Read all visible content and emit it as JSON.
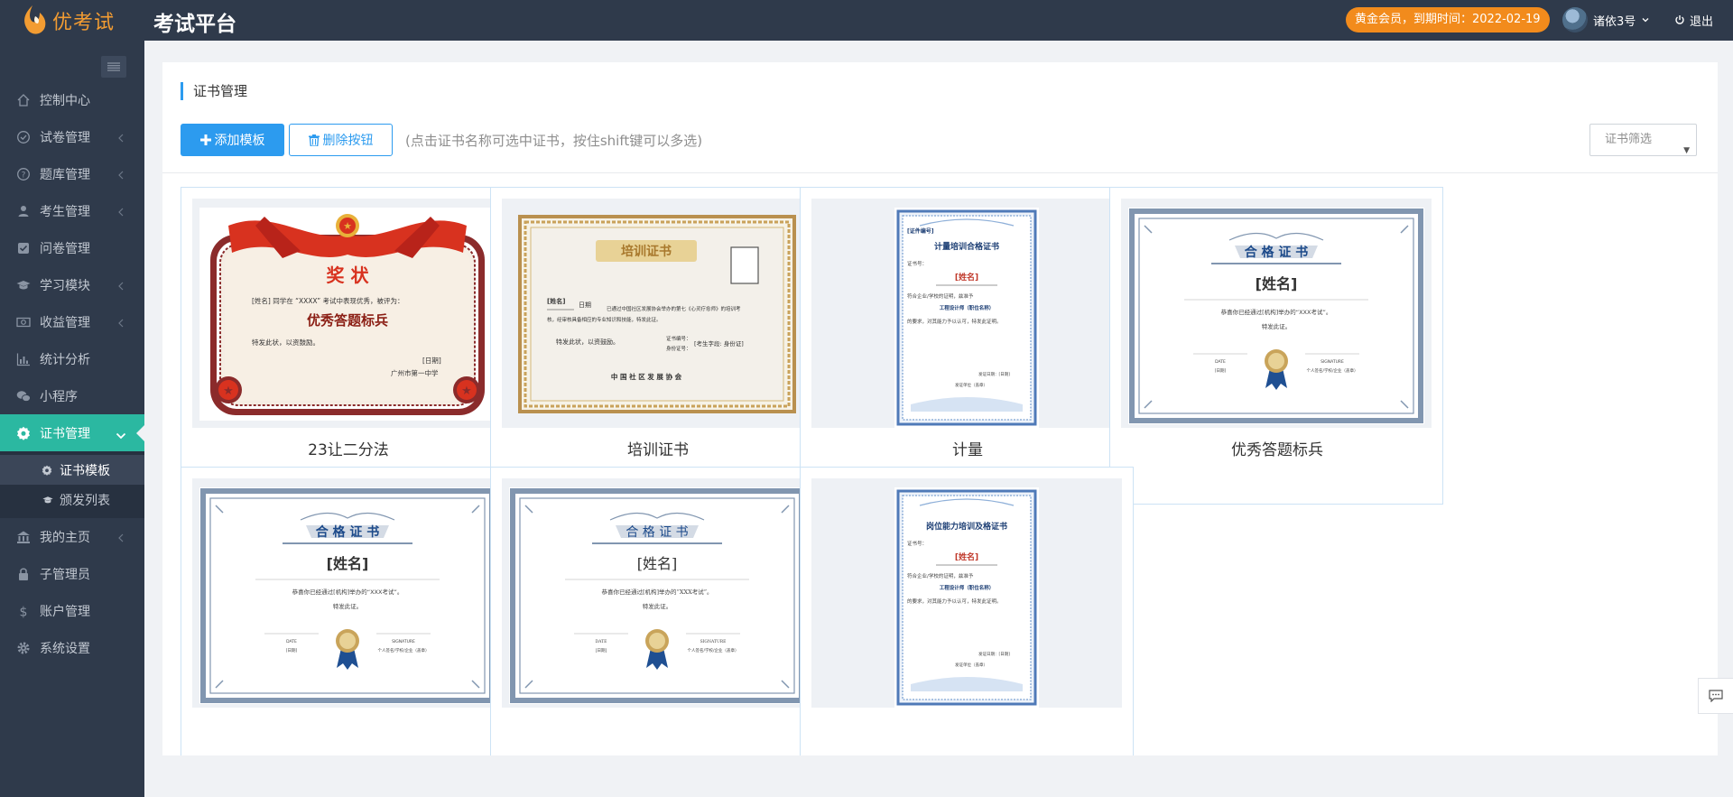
{
  "brand": {
    "logo_text": "优考试",
    "app_title": "考试平台"
  },
  "header": {
    "vip_label": "黄金会员，到期时间：2022-02-19",
    "username": "诸依3号",
    "logout_label": "退出"
  },
  "sidebar": {
    "items": [
      {
        "label": "控制中心",
        "icon": "home-icon",
        "expandable": false
      },
      {
        "label": "试卷管理",
        "icon": "check-circle-icon",
        "expandable": true
      },
      {
        "label": "题库管理",
        "icon": "question-circle-icon",
        "expandable": true
      },
      {
        "label": "考生管理",
        "icon": "user-icon",
        "expandable": true
      },
      {
        "label": "问卷管理",
        "icon": "checkbox-icon",
        "expandable": false
      },
      {
        "label": "学习模块",
        "icon": "graduation-cap-icon",
        "expandable": true
      },
      {
        "label": "收益管理",
        "icon": "money-icon",
        "expandable": true
      },
      {
        "label": "统计分析",
        "icon": "bar-chart-icon",
        "expandable": false
      },
      {
        "label": "小程序",
        "icon": "wechat-icon",
        "expandable": false
      },
      {
        "label": "证书管理",
        "icon": "certificate-icon",
        "expandable": true,
        "active": true
      },
      {
        "label": "我的主页",
        "icon": "bank-icon",
        "expandable": true
      },
      {
        "label": "子管理员",
        "icon": "lock-icon",
        "expandable": false
      },
      {
        "label": "账户管理",
        "icon": "dollar-icon",
        "expandable": false
      },
      {
        "label": "系统设置",
        "icon": "gear-icon",
        "expandable": false
      }
    ],
    "sub_items": [
      {
        "label": "证书模板",
        "icon": "certificate-small-icon",
        "current": true
      },
      {
        "label": "颁发列表",
        "icon": "graduation-cap-small-icon",
        "current": false
      }
    ]
  },
  "main": {
    "title": "证书管理",
    "add_button": "添加模板",
    "delete_button": "删除按钮",
    "hint": "(点击证书名称可选中证书，按住shift键可以多选)",
    "filter_placeholder": "证书筛选"
  },
  "certificates": [
    {
      "name": "23让二分法",
      "style": "award",
      "texts": {
        "heading": "奖 状",
        "line1": "[姓名] 同学在 “XXXX” 考试中表现优秀，被评为：",
        "title": "优秀答题标兵",
        "line2": "特发此状，以资鼓励。",
        "date": "[日期]",
        "org": "广州市第一中学"
      }
    },
    {
      "name": "培训证书",
      "style": "training",
      "texts": {
        "heading": "培训证书",
        "name_field": "[姓名]",
        "date_field": "日期",
        "line1": "已通过中国社区发展协会举办的第七《心灵疗愈师》的培训考",
        "line2": "核，经审核具备相应的专业知识和技能，特发此证。",
        "line3": "特发此状，以资鼓励。",
        "cert_no": "证书编号：",
        "id_no": "身份证号：",
        "id_field": "[考生字段: 身份证]",
        "org": "中 国 社 区 发 展 协 会"
      }
    },
    {
      "name": "计量",
      "style": "blue-portrait",
      "texts": {
        "corner": "[证件编号]",
        "heading": "计量培训合格证书",
        "cert_label": "证书号：",
        "name_field": "[姓名]",
        "line1": "符合企业/学校的证明，兹准予",
        "line2": "工程设计师（职位名称）",
        "line3": "的要求，对其能力予以认可，特发此证明。",
        "sign": "发证日期：[日期]",
        "org": "发证单位（盖章）"
      }
    },
    {
      "name": "优秀答题标兵",
      "style": "blue-frame",
      "texts": {
        "heading": "合 格 证 书",
        "name_field": "[姓名]",
        "line1": "恭喜你已经通过[机构]举办的“XXX考试”。",
        "line2": "特发此证。",
        "date_label": "DATE",
        "date_field": "[日期]",
        "sig_label": "SIGNATURE",
        "sig_field": "个人签名/学校/企业（盖章）"
      }
    },
    {
      "name": "",
      "style": "blue-frame",
      "texts": {
        "heading": "合 格 证 书",
        "name_field": "[姓名]",
        "line1": "恭喜你已经通过[机构]举办的“XXX考试”。",
        "line2": "特发此证。",
        "date_label": "DATE",
        "date_field": "[日期]",
        "sig_label": "SIGNATURE",
        "sig_field": "个人签名/学校/企业（盖章）"
      }
    },
    {
      "name": "",
      "style": "blue-frame-serif",
      "texts": {
        "heading": "合 格 证 书",
        "name_field": "[姓名]",
        "line1": "恭喜你已经通过[机构]举办的“XXX考试”。",
        "line2": "特发此证。",
        "date_label": "DATE",
        "date_field": "[日期]",
        "sig_label": "SIGNATURE",
        "sig_field": "个人签名/学校/企业（盖章）"
      }
    },
    {
      "name": "",
      "style": "blue-portrait",
      "texts": {
        "corner": "",
        "heading": "岗位能力培训及格证书",
        "cert_label": "证书号：",
        "name_field": "[姓名]",
        "line1": "符合企业/学校的证明，兹准予",
        "line2": "工程设计师（职位名称）",
        "line3": "的要求，对其能力予以认可，特发此证明。",
        "sign": "发证日期：[日期]",
        "org": "发证单位（盖章）"
      }
    }
  ],
  "colors": {
    "topbar": "#2f3a4b",
    "accent": "#2c9bef",
    "active_nav": "#2bb8a1",
    "vip": "#f28b1c",
    "logo": "#f39c32"
  }
}
